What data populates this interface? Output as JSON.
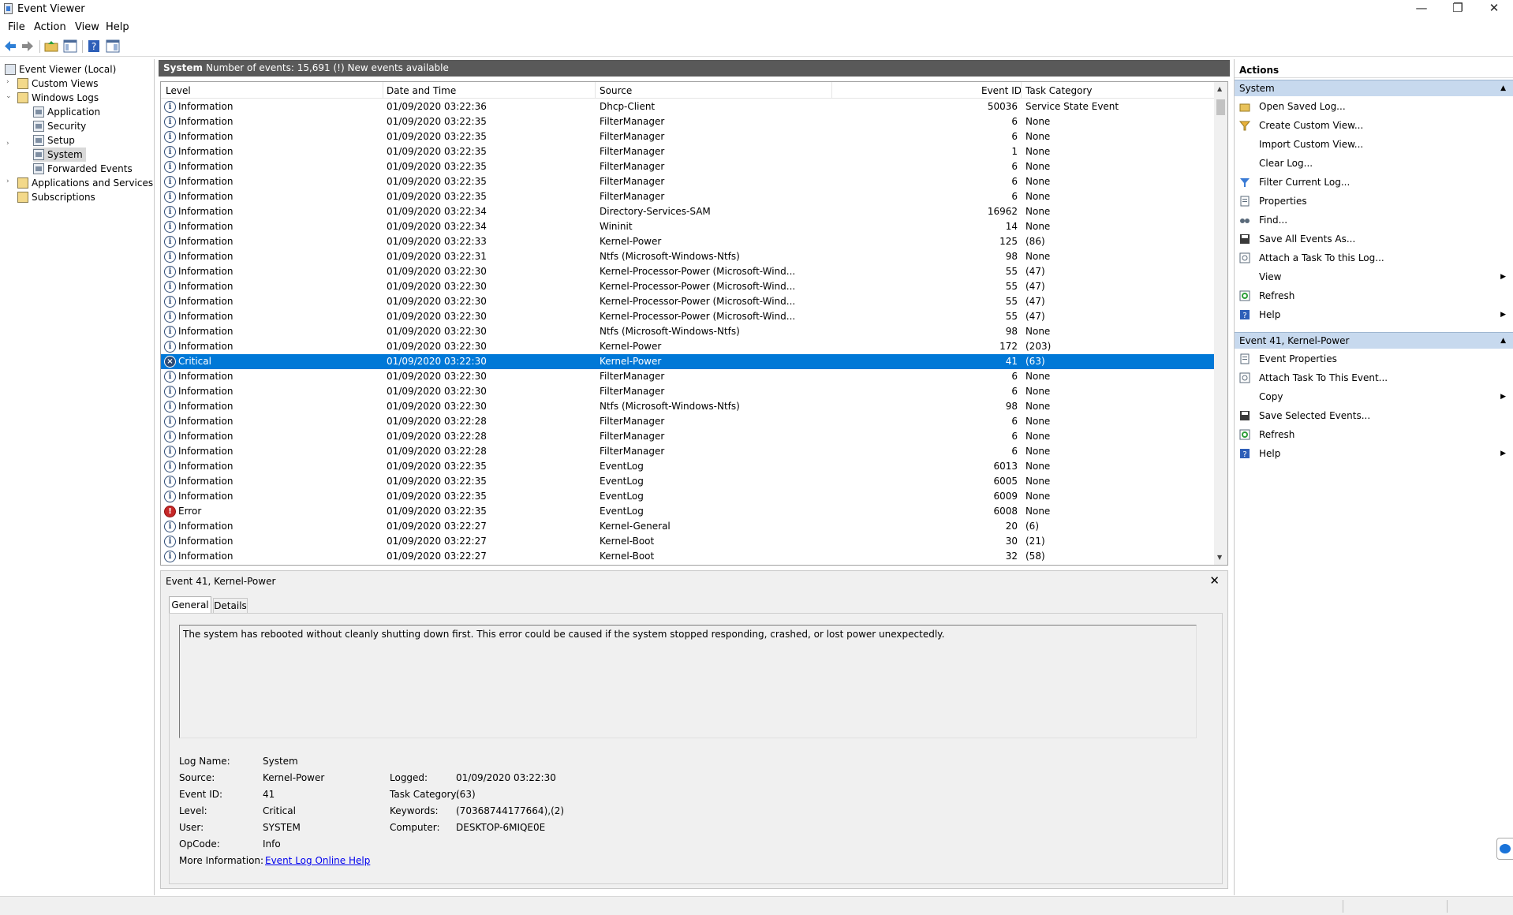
{
  "window": {
    "title": "Event Viewer",
    "minimize": "—",
    "restore": "❐",
    "close": "✕"
  },
  "menu": [
    "File",
    "Action",
    "View",
    "Help"
  ],
  "tree": {
    "root": "Event Viewer (Local)",
    "custom_views": "Custom Views",
    "windows_logs": "Windows Logs",
    "logs": [
      "Application",
      "Security",
      "Setup",
      "System",
      "Forwarded Events"
    ],
    "app_services": "Applications and Services Lo",
    "subscriptions": "Subscriptions"
  },
  "log_header": {
    "name": "System",
    "count": "Number of events: 15,691 (!) New events available"
  },
  "grid": {
    "columns": [
      "Level",
      "Date and Time",
      "Source",
      "Event ID",
      "Task Category"
    ],
    "rows": [
      {
        "level": "Information",
        "date": "01/09/2020 03:22:36",
        "source": "Dhcp-Client",
        "id": "50036",
        "task": "Service State Event"
      },
      {
        "level": "Information",
        "date": "01/09/2020 03:22:35",
        "source": "FilterManager",
        "id": "6",
        "task": "None"
      },
      {
        "level": "Information",
        "date": "01/09/2020 03:22:35",
        "source": "FilterManager",
        "id": "6",
        "task": "None"
      },
      {
        "level": "Information",
        "date": "01/09/2020 03:22:35",
        "source": "FilterManager",
        "id": "1",
        "task": "None"
      },
      {
        "level": "Information",
        "date": "01/09/2020 03:22:35",
        "source": "FilterManager",
        "id": "6",
        "task": "None"
      },
      {
        "level": "Information",
        "date": "01/09/2020 03:22:35",
        "source": "FilterManager",
        "id": "6",
        "task": "None"
      },
      {
        "level": "Information",
        "date": "01/09/2020 03:22:35",
        "source": "FilterManager",
        "id": "6",
        "task": "None"
      },
      {
        "level": "Information",
        "date": "01/09/2020 03:22:34",
        "source": "Directory-Services-SAM",
        "id": "16962",
        "task": "None"
      },
      {
        "level": "Information",
        "date": "01/09/2020 03:22:34",
        "source": "Wininit",
        "id": "14",
        "task": "None"
      },
      {
        "level": "Information",
        "date": "01/09/2020 03:22:33",
        "source": "Kernel-Power",
        "id": "125",
        "task": "(86)"
      },
      {
        "level": "Information",
        "date": "01/09/2020 03:22:31",
        "source": "Ntfs (Microsoft-Windows-Ntfs)",
        "id": "98",
        "task": "None"
      },
      {
        "level": "Information",
        "date": "01/09/2020 03:22:30",
        "source": "Kernel-Processor-Power (Microsoft-Wind...",
        "id": "55",
        "task": "(47)"
      },
      {
        "level": "Information",
        "date": "01/09/2020 03:22:30",
        "source": "Kernel-Processor-Power (Microsoft-Wind...",
        "id": "55",
        "task": "(47)"
      },
      {
        "level": "Information",
        "date": "01/09/2020 03:22:30",
        "source": "Kernel-Processor-Power (Microsoft-Wind...",
        "id": "55",
        "task": "(47)"
      },
      {
        "level": "Information",
        "date": "01/09/2020 03:22:30",
        "source": "Kernel-Processor-Power (Microsoft-Wind...",
        "id": "55",
        "task": "(47)"
      },
      {
        "level": "Information",
        "date": "01/09/2020 03:22:30",
        "source": "Ntfs (Microsoft-Windows-Ntfs)",
        "id": "98",
        "task": "None"
      },
      {
        "level": "Information",
        "date": "01/09/2020 03:22:30",
        "source": "Kernel-Power",
        "id": "172",
        "task": "(203)"
      },
      {
        "level": "Critical",
        "date": "01/09/2020 03:22:30",
        "source": "Kernel-Power",
        "id": "41",
        "task": "(63)"
      },
      {
        "level": "Information",
        "date": "01/09/2020 03:22:30",
        "source": "FilterManager",
        "id": "6",
        "task": "None"
      },
      {
        "level": "Information",
        "date": "01/09/2020 03:22:30",
        "source": "FilterManager",
        "id": "6",
        "task": "None"
      },
      {
        "level": "Information",
        "date": "01/09/2020 03:22:30",
        "source": "Ntfs (Microsoft-Windows-Ntfs)",
        "id": "98",
        "task": "None"
      },
      {
        "level": "Information",
        "date": "01/09/2020 03:22:28",
        "source": "FilterManager",
        "id": "6",
        "task": "None"
      },
      {
        "level": "Information",
        "date": "01/09/2020 03:22:28",
        "source": "FilterManager",
        "id": "6",
        "task": "None"
      },
      {
        "level": "Information",
        "date": "01/09/2020 03:22:28",
        "source": "FilterManager",
        "id": "6",
        "task": "None"
      },
      {
        "level": "Information",
        "date": "01/09/2020 03:22:35",
        "source": "EventLog",
        "id": "6013",
        "task": "None"
      },
      {
        "level": "Information",
        "date": "01/09/2020 03:22:35",
        "source": "EventLog",
        "id": "6005",
        "task": "None"
      },
      {
        "level": "Information",
        "date": "01/09/2020 03:22:35",
        "source": "EventLog",
        "id": "6009",
        "task": "None"
      },
      {
        "level": "Error",
        "date": "01/09/2020 03:22:35",
        "source": "EventLog",
        "id": "6008",
        "task": "None"
      },
      {
        "level": "Information",
        "date": "01/09/2020 03:22:27",
        "source": "Kernel-General",
        "id": "20",
        "task": "(6)"
      },
      {
        "level": "Information",
        "date": "01/09/2020 03:22:27",
        "source": "Kernel-Boot",
        "id": "30",
        "task": "(21)"
      },
      {
        "level": "Information",
        "date": "01/09/2020 03:22:27",
        "source": "Kernel-Boot",
        "id": "32",
        "task": "(58)"
      }
    ]
  },
  "detail": {
    "title": "Event 41, Kernel-Power",
    "close": "✕",
    "tabs": [
      "General",
      "Details"
    ],
    "description": "The system has rebooted without cleanly shutting down first. This error could be caused if the system stopped responding, crashed, or lost power unexpectedly.",
    "labels": {
      "log_name": "Log Name:",
      "source": "Source:",
      "event_id": "Event ID:",
      "level": "Level:",
      "user": "User:",
      "opcode": "OpCode:",
      "more_info": "More Information:",
      "logged": "Logged:",
      "task_category": "Task Category:",
      "keywords": "Keywords:",
      "computer": "Computer:"
    },
    "values": {
      "log_name": "System",
      "source": "Kernel-Power",
      "event_id": "41",
      "level": "Critical",
      "user": "SYSTEM",
      "opcode": "Info",
      "more_info": "Event Log Online Help",
      "logged": "01/09/2020 03:22:30",
      "task_category": "(63)",
      "keywords": "(70368744177664),(2)",
      "computer": "DESKTOP-6MIQE0E"
    }
  },
  "actions": {
    "title": "Actions",
    "section_system": "System",
    "system_items": [
      "Open Saved Log...",
      "Create Custom View...",
      "Import Custom View...",
      "Clear Log...",
      "Filter Current Log...",
      "Properties",
      "Find...",
      "Save All Events As...",
      "Attach a Task To this Log...",
      "View",
      "Refresh",
      "Help"
    ],
    "section_event": "Event 41, Kernel-Power",
    "event_items": [
      "Event Properties",
      "Attach Task To This Event...",
      "Copy",
      "Save Selected Events...",
      "Refresh",
      "Help"
    ]
  }
}
